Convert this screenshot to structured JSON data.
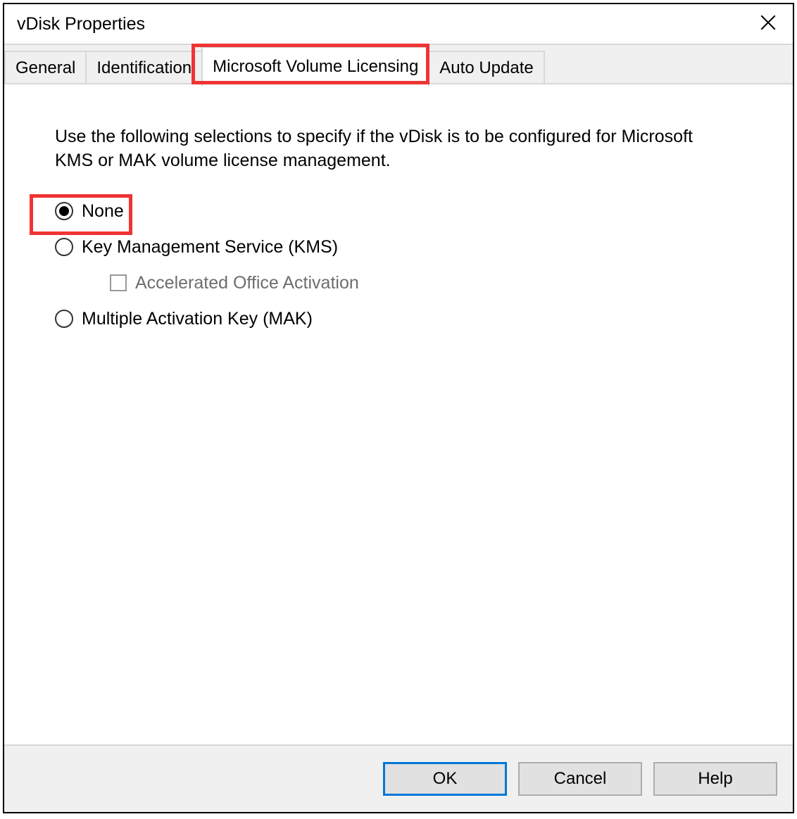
{
  "window": {
    "title": "vDisk Properties"
  },
  "tabs": [
    {
      "label": "General",
      "active": false
    },
    {
      "label": "Identification",
      "active": false
    },
    {
      "label": "Microsoft Volume Licensing",
      "active": true
    },
    {
      "label": "Auto Update",
      "active": false
    }
  ],
  "content": {
    "description": "Use the following selections to specify if the vDisk is to be configured for Microsoft KMS or MAK volume license management.",
    "options": {
      "none": {
        "label": "None",
        "selected": true
      },
      "kms": {
        "label": "Key Management Service (KMS)",
        "selected": false
      },
      "accelerated": {
        "label": "Accelerated Office Activation",
        "checked": false,
        "enabled": false
      },
      "mak": {
        "label": "Multiple Activation Key (MAK)",
        "selected": false
      }
    }
  },
  "footer": {
    "ok": "OK",
    "cancel": "Cancel",
    "help": "Help"
  },
  "highlights": {
    "color": "#ef3434"
  }
}
